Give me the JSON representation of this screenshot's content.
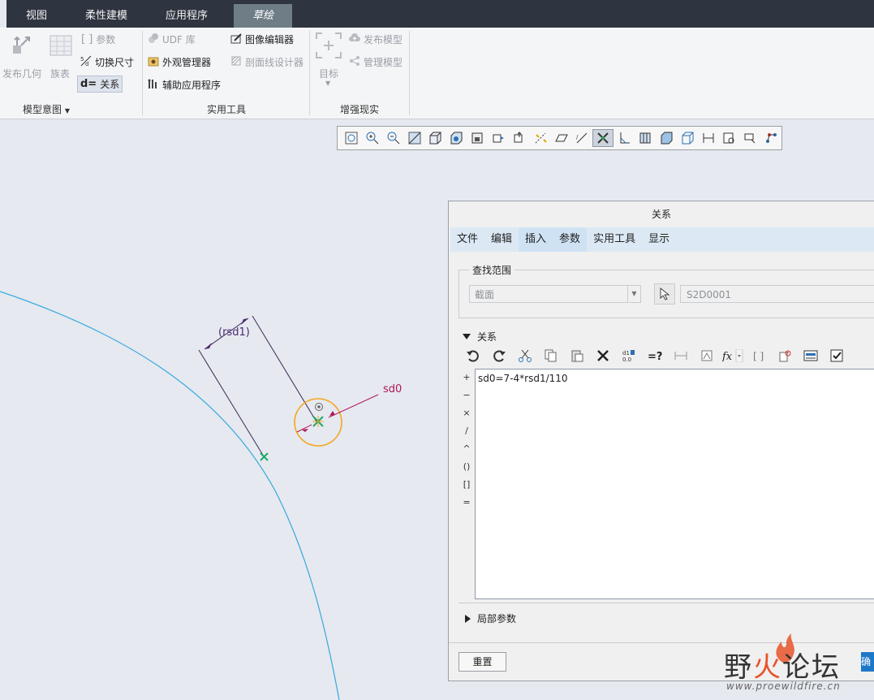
{
  "tabs": [
    {
      "label": "视图"
    },
    {
      "label": "柔性建模"
    },
    {
      "label": "应用程序"
    },
    {
      "label": "草绘"
    }
  ],
  "ribbon": {
    "publish_geom": "发布几何",
    "family_table": "族表",
    "params": "参数",
    "toggle_dims": "切换尺寸",
    "relations": "关系",
    "group_model_intent": "模型意图",
    "udf_lib": "UDF 库",
    "appearance_mgr": "外观管理器",
    "aux_apps": "辅助应用程序",
    "image_editor": "图像编辑器",
    "xsec_designer": "剖面线设计器",
    "group_utilities": "实用工具",
    "target": "目标",
    "publish_model": "发布模型",
    "manage_model": "管理模型",
    "group_ar": "增强现实"
  },
  "sketch": {
    "dim_rsd1": "(rsd1)",
    "dim_sd0": "sd0"
  },
  "dialog": {
    "title": "关系",
    "menu": [
      {
        "label": "文件"
      },
      {
        "label": "编辑"
      },
      {
        "label": "插入"
      },
      {
        "label": "参数"
      },
      {
        "label": "实用工具"
      },
      {
        "label": "显示"
      }
    ],
    "lookin_legend": "查找范围",
    "lookin_value": "截面",
    "lookin_id": "S2D0001",
    "relations_section": "关系",
    "operators": [
      "+",
      "−",
      "×",
      "/",
      "^",
      "()",
      "[]",
      "="
    ],
    "relation_text": "sd0=7-4*rsd1/110",
    "local_params": "局部参数",
    "reset": "重置",
    "confirm": "确定"
  },
  "watermark": {
    "brand_black1": "野",
    "brand_red": "火",
    "brand_black2": "论坛",
    "url": "www.proewildfire.cn"
  },
  "colors": {
    "topbar": "#2e3440",
    "active_tab": "#6f7d87",
    "curve": "#36a9e1",
    "dim_line": "#3b2a5c",
    "dim_text": "#4b2a72",
    "sd0_text": "#b0175a",
    "circle": "#f5a623",
    "point": "#1ea86a",
    "menubar": "#dce9f5"
  }
}
